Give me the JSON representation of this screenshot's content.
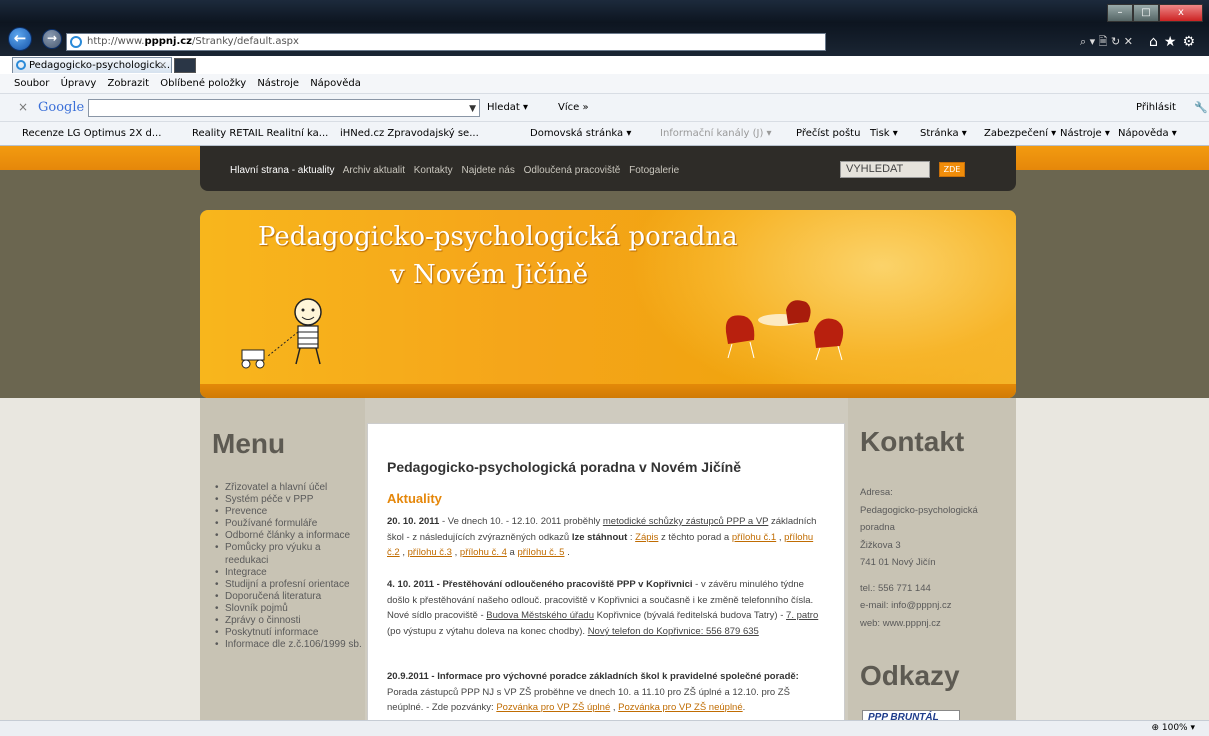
{
  "browser": {
    "url_prefix": "http://www.",
    "url_domain": "pppnj.cz",
    "url_path": "/Stranky/default.aspx",
    "addr_tools": "⌕ ▾ 🗎 ↻ ✕",
    "tab_label": "Pedagogicko-psychologick...",
    "tab_close": "×",
    "menu": [
      "Soubor",
      "Úpravy",
      "Zobrazit",
      "Oblíbené položky",
      "Nástroje",
      "Nápověda"
    ],
    "google": {
      "label": "Google",
      "search_label": "Hledat ▾",
      "more_label": "Více »",
      "signin_label": "Přihlásit"
    },
    "favorites": [
      "Recenze LG Optimus 2X d...",
      "Reality RETAIL Realitní ka...",
      "iHNed.cz Zpravodajský se...",
      "Domovská stránka ▾",
      "Informační kanály (J) ▾",
      "Přečíst poštu",
      "Tisk ▾",
      "Stránka ▾",
      "Zabezpečení ▾",
      "Nástroje ▾",
      "Nápověda ▾"
    ],
    "zoom": "100%"
  },
  "site": {
    "nav": [
      "Hlavní strana - aktuality",
      "Archiv aktualit",
      "Kontakty",
      "Najdete nás",
      "Odloučená pracoviště",
      "Fotogalerie"
    ],
    "search_placeholder": "VYHLEDAT",
    "search_button": "ZDE",
    "banner_line1": "Pedagogicko-psychologická poradna",
    "banner_line2": "v Novém Jičíně",
    "menu_title": "Menu",
    "menu_items": [
      "Zřizovatel a hlavní účel",
      "Systém péče v PPP",
      "Prevence",
      "Používané formuláře",
      "Odborné články a informace",
      "Pomůcky pro výuku a reedukaci",
      "Integrace",
      "Studijní a profesní orientace",
      "Doporučená literatura",
      "Slovník pojmů",
      "Zprávy o činnosti",
      "Poskytnutí informace",
      "Informace dle z.č.106/1999 sb."
    ],
    "content_title": "Pedagogicko-psychologická poradna v Novém Jičíně",
    "aktuality": "Aktuality",
    "news": [
      {
        "date": "20. 10. 2011",
        "t1": " - Ve dnech 10. - 12.10. 2011 proběhly ",
        "l1": "metodické schůzky zástupců PPP a VP",
        "t2": " základních škol  - z následujících zvýrazněných odkazů ",
        "b1": "lze stáhnout",
        "t3": " :  ",
        "l2": "Zápis",
        "t4": "  z těchto porad a ",
        "l3": "přílohu č.1",
        "l4": "přílohu č.2",
        "l5": "přílohu č.3",
        "l6": "přílohu č. 4",
        "l7": "přílohu č. 5",
        "sep1": " ,  ",
        "sep2": "  a  ",
        "end": " ."
      },
      {
        "date": "4. 10. 2011",
        "b1": " - Přestěhování odloučeného pracoviště PPP v Kopřivnici",
        "t1": " - v závěru minulého týdne došlo k přestěhování našeho odlouč. pracoviště v Kopřivnici a současně i ke změně telefonního čísla. Nové sídlo pracoviště - ",
        "l1": "Budova Městského úřadu",
        "t2": " Kopřivnice (bývalá ředitelská budova Tatry) - ",
        "l2": "7. patro",
        "t3": "  (po výstupu z výtahu doleva na konec chodby). ",
        "l3": "Nový telefon do Kopřivnice: 556 879 635"
      },
      {
        "date": "20.9.2011",
        "b1": " - Informace pro výchovné poradce základních škol k pravidelné společné poradě:",
        "t1": " Porada zástupců PPP NJ s VP ZŠ proběhne ve dnech 10. a 11.10 pro ZŠ úplné a 12.10. pro ZŠ neúplné. - Zde pozvánky:  ",
        "l1": "Pozvánka pro VP ZŠ úplné",
        "t2": " ,  ",
        "l2": "Pozvánka pro VP ZŠ neúplné",
        "end": "."
      }
    ],
    "kontakt_title": "Kontakt",
    "kontakt_lines": [
      "Adresa:",
      "Pedagogicko-psychologická poradna",
      "Žižkova 3",
      "741 01 Nový Jičín",
      "",
      "tel.: 556 771 144",
      "e-mail: info@pppnj.cz",
      "web: www.pppnj.cz"
    ],
    "odkazy_title": "Odkazy",
    "odkazy_badge": "PPP BRUNTÁL"
  },
  "colors": {
    "orange": "#f08d0a",
    "dark_band": "#6b6650",
    "link": "#c06c02"
  }
}
